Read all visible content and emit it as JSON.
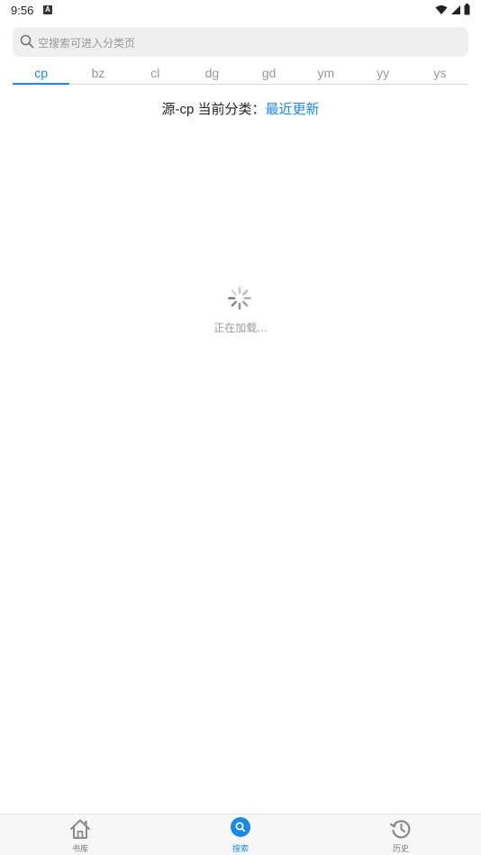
{
  "status_bar": {
    "time": "9:56",
    "notification_icon_letter": "A",
    "icons": [
      "wifi-icon",
      "signal-icon",
      "battery-icon"
    ]
  },
  "search": {
    "placeholder": "空搜索可进入分类页"
  },
  "tabs": [
    {
      "label": "cp",
      "active": true
    },
    {
      "label": "bz",
      "active": false
    },
    {
      "label": "cl",
      "active": false
    },
    {
      "label": "dg",
      "active": false
    },
    {
      "label": "gd",
      "active": false
    },
    {
      "label": "ym",
      "active": false
    },
    {
      "label": "yy",
      "active": false
    },
    {
      "label": "ys",
      "active": false
    }
  ],
  "category": {
    "prefix": "源-cp 当前分类：",
    "value": "最近更新"
  },
  "loading": {
    "text": "正在加载..."
  },
  "bottom_nav": {
    "items": [
      {
        "label": "书库",
        "icon": "home-icon",
        "active": false
      },
      {
        "label": "搜索",
        "icon": "search-icon",
        "active": true
      },
      {
        "label": "历史",
        "icon": "history-icon",
        "active": false
      }
    ]
  },
  "colors": {
    "accent": "#1e88e5",
    "muted_text": "#9a9a9a",
    "search_bg": "#efefef",
    "nav_bg": "#f7f7f7"
  }
}
